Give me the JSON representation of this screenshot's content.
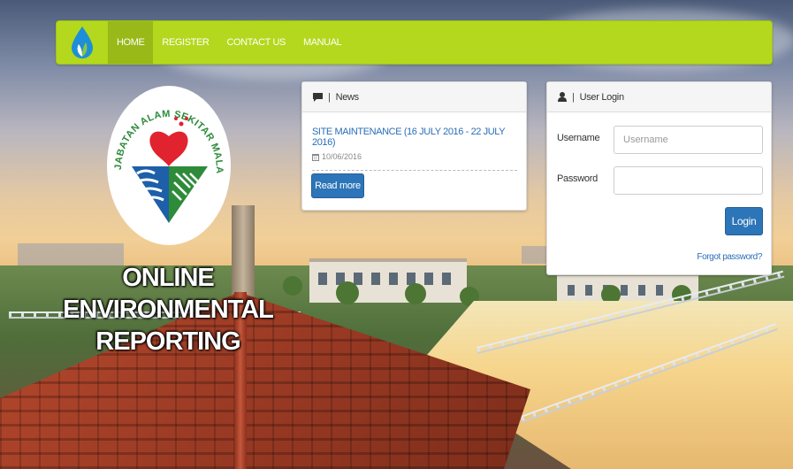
{
  "navbar": {
    "brand_icon": "water-drop-leaf-icon",
    "items": [
      {
        "label": "HOME",
        "active": true
      },
      {
        "label": "REGISTER",
        "active": false
      },
      {
        "label": "CONTACT US",
        "active": false
      },
      {
        "label": "MANUAL",
        "active": false
      }
    ],
    "color": "#b3d81d"
  },
  "logo": {
    "org_name": "JABATAN ALAM SEKITAR MALAYSIA"
  },
  "title": {
    "line1": "ONLINE",
    "line2": "ENVIRONMENTAL",
    "line3": "REPORTING"
  },
  "news": {
    "heading_icon": "comment-icon",
    "heading": "News",
    "item_title": "SITE MAINTENANCE (16 JULY 2016 - 22 JULY 2016)",
    "item_date_icon": "calendar-icon",
    "item_date": "10/06/2016",
    "read_more": "Read more"
  },
  "login": {
    "heading_icon": "user-icon",
    "heading": "User Login",
    "username_label": "Username",
    "username_placeholder": "Username",
    "password_label": "Password",
    "password_placeholder": "",
    "login_button": "Login",
    "forgot_password": "Forgot password?"
  },
  "colors": {
    "primary_button": "#2c75b8",
    "link": "#2a6eb8"
  }
}
